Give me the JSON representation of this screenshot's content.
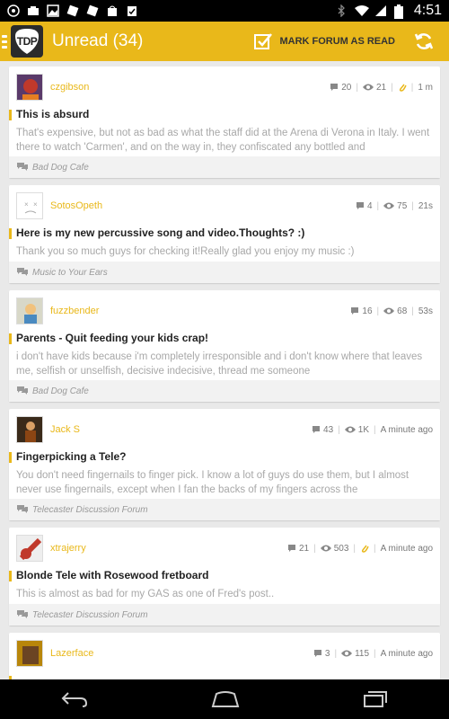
{
  "status_bar": {
    "time": "4:51"
  },
  "app_bar": {
    "logo": "TDP",
    "title": "Unread (34)",
    "mark_read_label": "MARK FORUM AS READ"
  },
  "posts": [
    {
      "username": "czgibson",
      "replies": "20",
      "views": "21",
      "time": "1 m",
      "has_attachment": true,
      "title": "This is absurd",
      "excerpt": "That's expensive, but not as bad as what the staff did at the Arena di Verona in Italy. I went there to watch 'Carmen', and on the way in, they confiscated any bottled and",
      "forum": "Bad Dog Cafe"
    },
    {
      "username": "SotosOpeth",
      "replies": "4",
      "views": "75",
      "time": "21s",
      "has_attachment": false,
      "title": "Here is my new percussive song and video.Thoughts? :)",
      "excerpt": "Thank you so much guys for checking it!Really glad you enjoy my music :)",
      "forum": "Music to Your Ears"
    },
    {
      "username": "fuzzbender",
      "replies": "16",
      "views": "68",
      "time": "53s",
      "has_attachment": false,
      "title": "Parents - Quit feeding your kids crap!",
      "excerpt": "i don't have kids because i'm completely irresponsible and i don't know where that leaves me, selfish or unselfish, decisive indecisive, thread me someone",
      "forum": "Bad Dog Cafe"
    },
    {
      "username": "Jack S",
      "replies": "43",
      "views": "1K",
      "time": "A minute ago",
      "has_attachment": false,
      "title": "Fingerpicking a Tele?",
      "excerpt": "You don't need fingernails to finger pick. I know a lot of guys do use them, but I almost never use fingernails, except when I fan the backs of my fingers across the",
      "forum": "Telecaster Discussion Forum"
    },
    {
      "username": "xtrajerry",
      "replies": "21",
      "views": "503",
      "time": "A minute ago",
      "has_attachment": true,
      "title": "Blonde Tele with Rosewood fretboard",
      "excerpt": "This is almost as bad for my GAS as one of Fred's post..",
      "forum": "Telecaster Discussion Forum"
    },
    {
      "username": "Lazerface",
      "replies": "3",
      "views": "115",
      "time": "A minute ago",
      "has_attachment": false,
      "title": "",
      "excerpt": "",
      "forum": ""
    }
  ],
  "colors": {
    "accent": "#e9b81a",
    "background": "#e9e9e9",
    "status_bar": "#000000"
  }
}
